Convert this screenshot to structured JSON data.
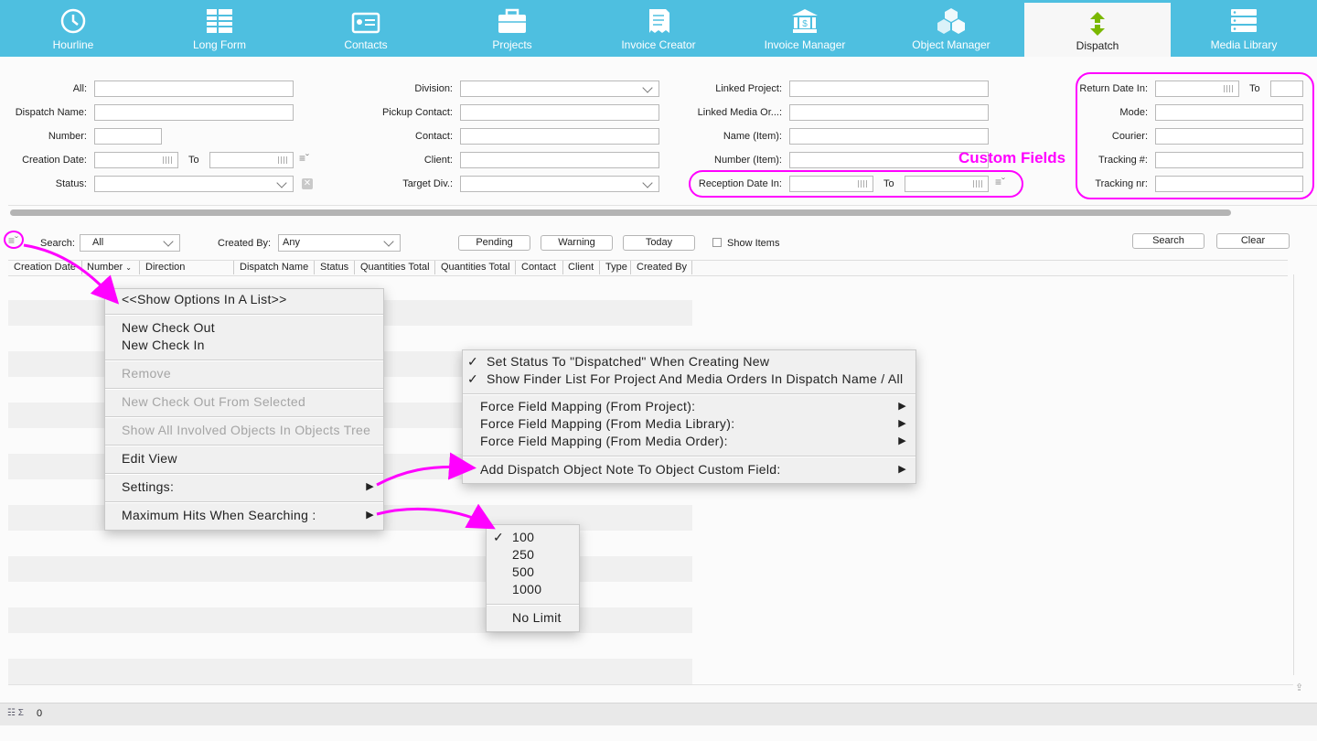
{
  "tabs": [
    {
      "label": "Hourline",
      "icon": "clock-icon"
    },
    {
      "label": "Long Form",
      "icon": "long-form-icon"
    },
    {
      "label": "Contacts",
      "icon": "contacts-icon"
    },
    {
      "label": "Projects",
      "icon": "briefcase-icon"
    },
    {
      "label": "Invoice Creator",
      "icon": "invoice-icon"
    },
    {
      "label": "Invoice Manager",
      "icon": "bank-icon"
    },
    {
      "label": "Object Manager",
      "icon": "cubes-icon"
    },
    {
      "label": "Dispatch",
      "icon": "dispatch-arrows-icon"
    },
    {
      "label": "Media Library",
      "icon": "server-icon"
    }
  ],
  "active_tab": "Dispatch",
  "form": {
    "all": "All:",
    "dispatch_name": "Dispatch Name:",
    "number": "Number:",
    "creation_date": "Creation Date:",
    "to": "To",
    "status": "Status:",
    "division": "Division:",
    "pickup_contact": "Pickup Contact:",
    "contact": "Contact:",
    "client": "Client:",
    "target_div": "Target Div.:",
    "linked_project": "Linked Project:",
    "linked_media": "Linked Media Or...:",
    "name_item": "Name (Item):",
    "number_item": "Number (Item):",
    "reception_date": "Reception Date In:",
    "return_date": "Return Date In:",
    "mode": "Mode:",
    "courier": "Courier:",
    "tracking_hash": "Tracking #:",
    "tracking_nr": "Tracking nr:",
    "custom_fields_annotation": "Custom Fields"
  },
  "toolbar": {
    "search_label": "Search:",
    "search_value": "All",
    "created_by_label": "Created By:",
    "created_by_value": "Any",
    "pending": "Pending",
    "warning": "Warning",
    "today": "Today",
    "show_items": "Show Items",
    "search_button": "Search",
    "clear_button": "Clear"
  },
  "columns": [
    "Creation Date",
    "Number",
    "Direction",
    "Dispatch Name",
    "Status",
    "Quantities Total",
    "Quantities Total",
    "Contact",
    "Client",
    "Type",
    "Created By"
  ],
  "context_menu": {
    "show_options": "<<Show Options In A List>>",
    "new_check_out": "New Check Out",
    "new_check_in": "New Check In",
    "remove": "Remove",
    "new_check_out_selected": "New Check Out From Selected",
    "show_all_involved": "Show All Involved Objects In Objects Tree",
    "edit_view": "Edit View",
    "settings": "Settings:",
    "max_hits": "Maximum Hits When Searching :"
  },
  "settings_menu": {
    "set_status": "Set Status To \"Dispatched\" When Creating New",
    "show_finder": "Show Finder List For Project And Media Orders In Dispatch Name / All",
    "force_project": "Force Field Mapping (From Project):",
    "force_media_library": "Force Field Mapping (From Media Library):",
    "force_media_order": "Force Field Mapping (From Media Order):",
    "add_note": "Add Dispatch Object Note To Object Custom Field:"
  },
  "hits_menu": {
    "options": [
      "100",
      "250",
      "500",
      "1000"
    ],
    "selected": "100",
    "no_limit": "No Limit"
  },
  "statusbar": {
    "count": "0"
  },
  "colors": {
    "tabbar": "#4ebfe0",
    "highlight": "#ff00ff",
    "dispatch_icon": "#7ab800"
  }
}
